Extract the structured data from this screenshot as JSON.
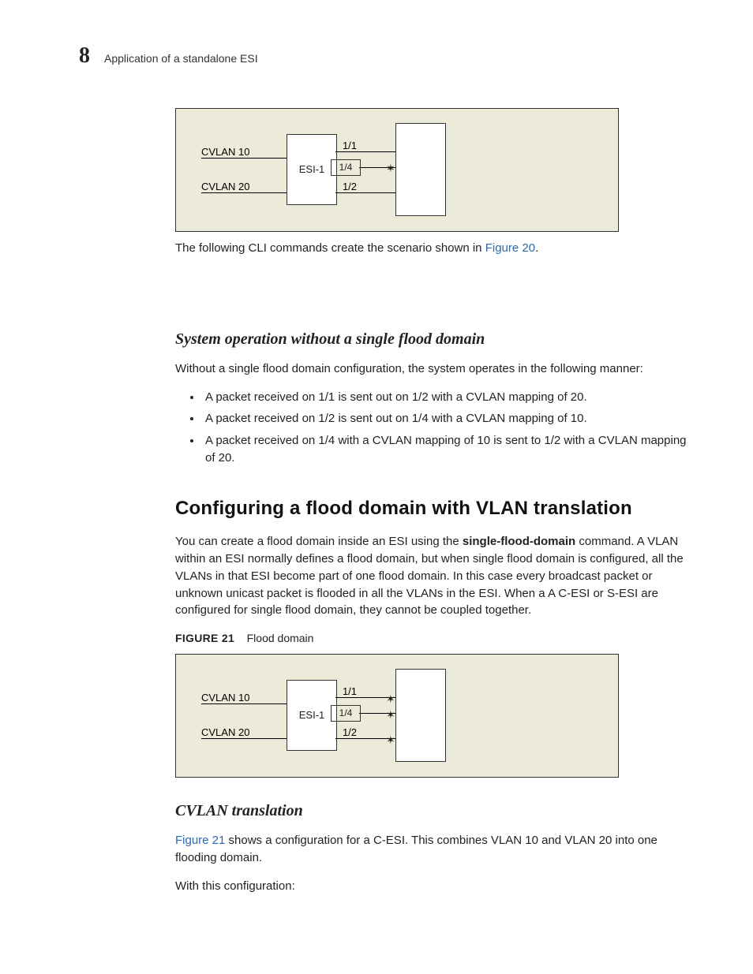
{
  "header": {
    "chapter_number": "8",
    "section_title": "Application of a standalone ESI"
  },
  "figure20": {
    "cvlan10": "CVLAN 10",
    "cvlan20": "CVLAN 20",
    "esi": "ESI-1",
    "port_1_1": "1/1",
    "port_1_4": "1/4",
    "port_1_2": "1/2"
  },
  "caption20_prefix": "The following CLI commands create the scenario shown in ",
  "caption20_link": "Figure 20",
  "caption20_suffix": ".",
  "section1": {
    "heading": "System operation without a single flood domain",
    "intro": "Without a single flood domain configuration, the system operates in the following manner:",
    "bullets": [
      "A packet received on 1/1 is sent out on 1/2 with a CVLAN mapping of 20.",
      "A packet received on 1/2 is sent out on 1/4 with a CVLAN mapping of 10.",
      "A packet received on 1/4 with a CVLAN mapping of 10 is sent to 1/2 with a CVLAN mapping of 20."
    ]
  },
  "section2": {
    "heading": "Configuring a flood domain with VLAN translation",
    "para_pre": "You can create a flood domain inside an ESI using the ",
    "para_bold": "single-flood-domain",
    "para_post": " command. A VLAN within an ESI normally defines a flood domain, but when single flood domain is configured, all the VLANs in that ESI become part of one flood domain. In this case every broadcast packet or unknown unicast packet is flooded in all the VLANs in the ESI. When a A C-ESI or S-ESI are configured for single flood domain, they cannot be coupled together."
  },
  "figure21_caption": {
    "label": "FIGURE 21",
    "title": "Flood domain"
  },
  "figure21": {
    "cvlan10": "CVLAN 10",
    "cvlan20": "CVLAN 20",
    "esi": "ESI-1",
    "port_1_1": "1/1",
    "port_1_4": "1/4",
    "port_1_2": "1/2"
  },
  "section3": {
    "heading": "CVLAN translation",
    "para1_link": "Figure 21",
    "para1_rest": " shows a configuration for a C-ESI. This combines VLAN 10 and VLAN 20 into one flooding domain.",
    "para2": "With this configuration:"
  }
}
